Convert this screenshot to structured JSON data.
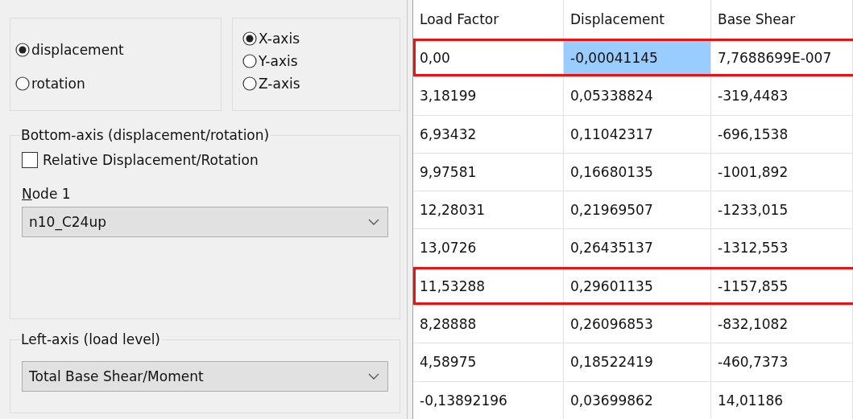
{
  "quantity_group": {
    "options": [
      {
        "label": "displacement",
        "selected": true
      },
      {
        "label": "rotation",
        "selected": false
      }
    ]
  },
  "axis_group": {
    "options": [
      {
        "label": "X-axis",
        "selected": true
      },
      {
        "label": "Y-axis",
        "selected": false
      },
      {
        "label": "Z-axis",
        "selected": false
      }
    ]
  },
  "bottom_axis": {
    "title": "Bottom-axis (displacement/rotation)",
    "checkbox": {
      "label": "Relative Displacement/Rotation",
      "checked": false
    },
    "node_label": "Node 1",
    "node_label_mnemonic_underlined": true,
    "node_value": "n10_C24up"
  },
  "left_axis": {
    "title": "Left-axis (load level)",
    "value": "Total Base Shear/Moment"
  },
  "table": {
    "columns": [
      "Load Factor",
      "Displacement",
      "Base Shear"
    ],
    "rows": [
      {
        "highlighted": true,
        "cells": [
          {
            "text": "0,00",
            "selected": false
          },
          {
            "text": "-0,00041145",
            "selected": true
          },
          {
            "text": "7,7688699E-007",
            "selected": false
          }
        ]
      },
      {
        "highlighted": false,
        "cells": [
          {
            "text": "3,18199",
            "selected": false
          },
          {
            "text": "0,05338824",
            "selected": false
          },
          {
            "text": "-319,4483",
            "selected": false
          }
        ]
      },
      {
        "highlighted": false,
        "cells": [
          {
            "text": "6,93432",
            "selected": false
          },
          {
            "text": "0,11042317",
            "selected": false
          },
          {
            "text": "-696,1538",
            "selected": false
          }
        ]
      },
      {
        "highlighted": false,
        "cells": [
          {
            "text": "9,97581",
            "selected": false
          },
          {
            "text": "0,16680135",
            "selected": false
          },
          {
            "text": "-1001,892",
            "selected": false
          }
        ]
      },
      {
        "highlighted": false,
        "cells": [
          {
            "text": "12,28031",
            "selected": false
          },
          {
            "text": "0,21969507",
            "selected": false
          },
          {
            "text": "-1233,015",
            "selected": false
          }
        ]
      },
      {
        "highlighted": false,
        "cells": [
          {
            "text": "13,0726",
            "selected": false
          },
          {
            "text": "0,26435137",
            "selected": false
          },
          {
            "text": "-1312,553",
            "selected": false
          }
        ]
      },
      {
        "highlighted": true,
        "cells": [
          {
            "text": "11,53288",
            "selected": false
          },
          {
            "text": "0,29601135",
            "selected": false
          },
          {
            "text": "-1157,855",
            "selected": false
          }
        ]
      },
      {
        "highlighted": false,
        "cells": [
          {
            "text": "8,28888",
            "selected": false
          },
          {
            "text": "0,26096853",
            "selected": false
          },
          {
            "text": "-832,1082",
            "selected": false
          }
        ]
      },
      {
        "highlighted": false,
        "cells": [
          {
            "text": "4,58975",
            "selected": false
          },
          {
            "text": "0,18522419",
            "selected": false
          },
          {
            "text": "-460,7373",
            "selected": false
          }
        ]
      },
      {
        "highlighted": false,
        "cells": [
          {
            "text": "-0,13892196",
            "selected": false
          },
          {
            "text": "0,03699862",
            "selected": false
          },
          {
            "text": "14,01186",
            "selected": false
          }
        ]
      }
    ]
  }
}
